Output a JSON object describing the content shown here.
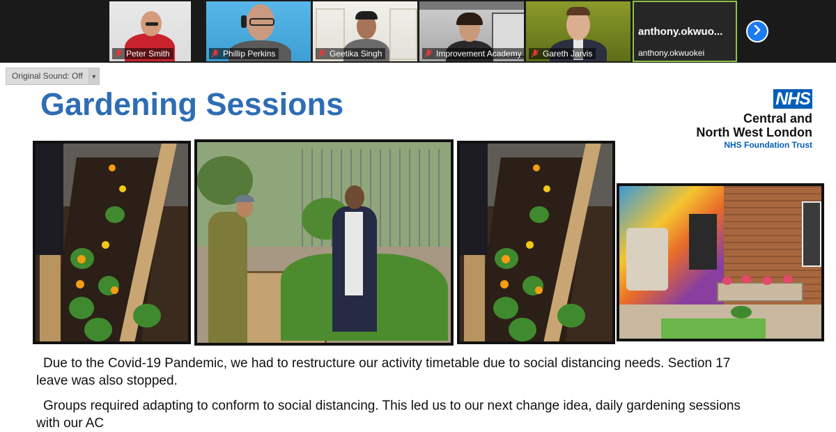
{
  "participants": [
    {
      "name": "Peter Smith",
      "muted": true
    },
    {
      "name": "Phillip Perkins",
      "muted": true
    },
    {
      "name": "Geetika Singh",
      "muted": true
    },
    {
      "name": "Improvement Academy",
      "muted": true
    },
    {
      "name": "Gareth Jarvis",
      "muted": true
    },
    {
      "name": "anthony.okwuokei",
      "display": "anthony.okwuo...",
      "muted": false
    }
  ],
  "controls": {
    "original_sound": "Original Sound: Off"
  },
  "slide": {
    "title": "Gardening Sessions",
    "logo": {
      "badge": "NHS",
      "line1": "Central and",
      "line2": "North West London",
      "line3": "NHS Foundation Trust"
    },
    "paragraphs": [
      {
        "line1": "Due to the Covid-19 Pandemic, we had to restructure our activity timetable due to social distancing needs. Section 17",
        "line2": "leave was also stopped."
      },
      {
        "line1": "Groups required adapting to conform to social distancing. This led us to our next change idea, daily gardening sessions",
        "line2": "with our AC"
      }
    ]
  },
  "colors": {
    "title": "#2e6db4",
    "nhs_blue": "#005eb8",
    "speaker_border": "#8bc34a",
    "next_button": "#1d7bf2"
  }
}
